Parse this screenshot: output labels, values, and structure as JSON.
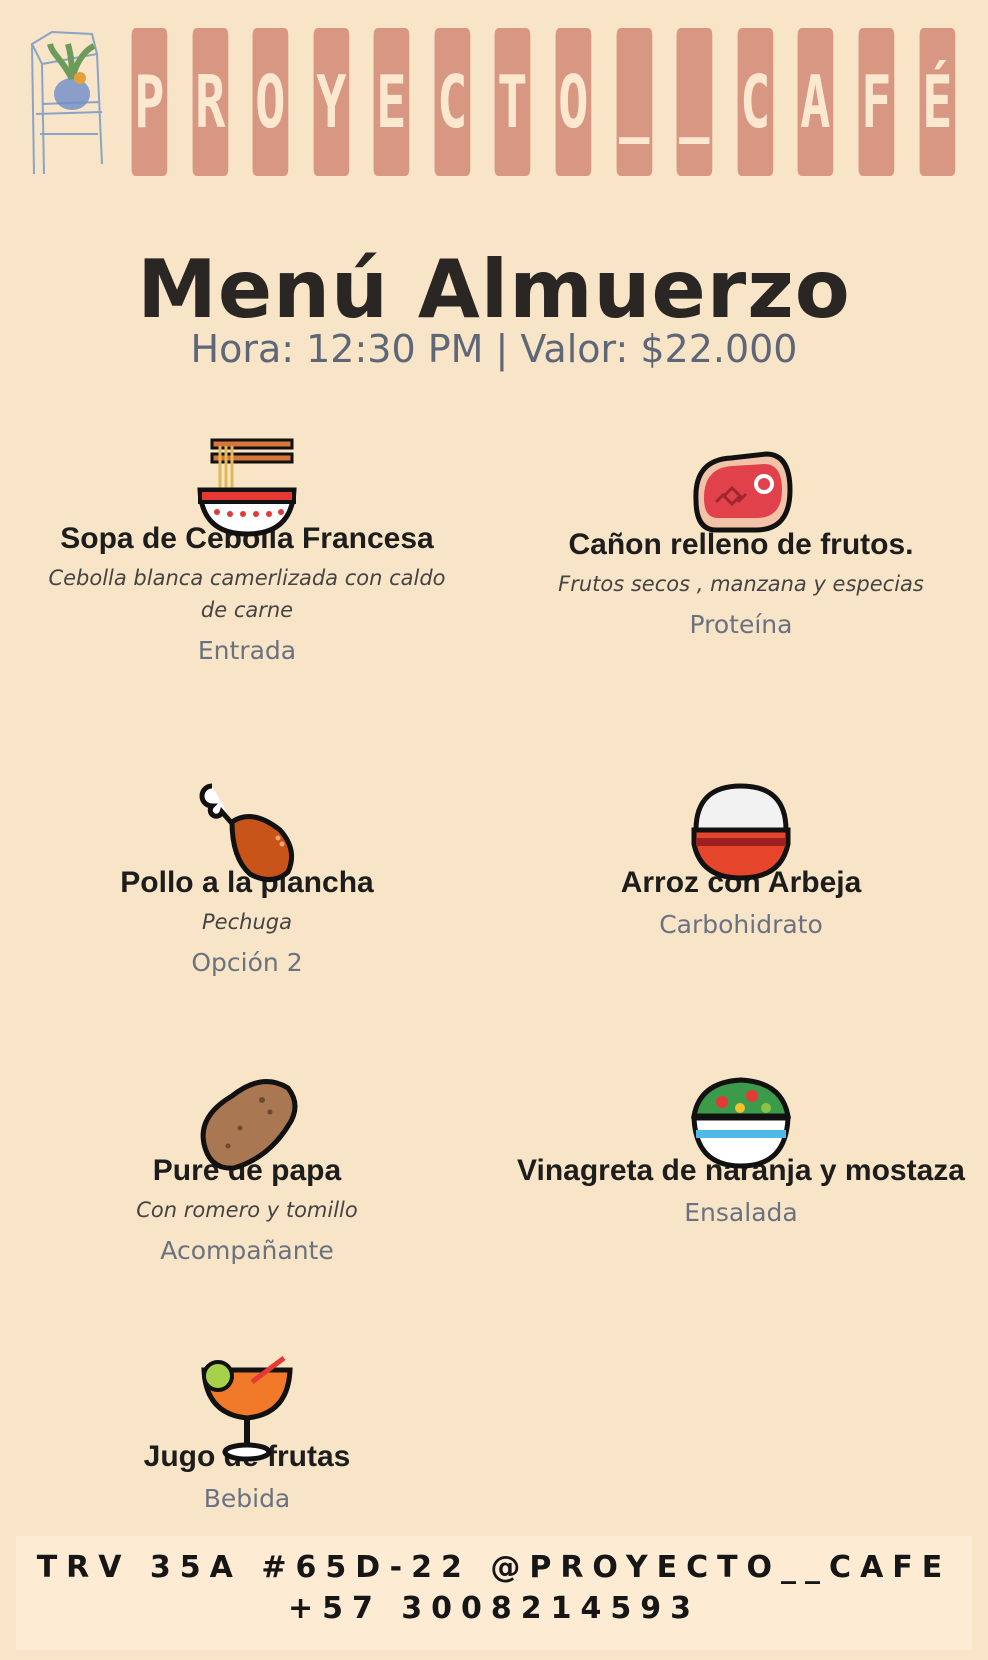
{
  "brand": {
    "letters": [
      "P",
      "R",
      "O",
      "Y",
      "E",
      "C",
      "T",
      "O",
      "_",
      "_",
      "C",
      "A",
      "F",
      "É"
    ],
    "tile_color": "#d89783",
    "letter_color": "#fbe8cf"
  },
  "header": {
    "title": "Menú Almuerzo",
    "subtitle": "Hora: 12:30 PM | Valor: $22.000"
  },
  "items": [
    {
      "icon": "ramen-bowl-icon",
      "name": "Sopa de Cebolla Francesa",
      "desc": "Cebolla blanca camerlizada con caldo de carne",
      "cat": "Entrada"
    },
    {
      "icon": "steak-icon",
      "name": "Cañon relleno de frutos.",
      "desc": "Frutos secos , manzana y especias",
      "cat": "Proteína"
    },
    {
      "icon": "chicken-leg-icon",
      "name": "Pollo a la plancha",
      "desc": "Pechuga",
      "cat": "Opción 2"
    },
    {
      "icon": "rice-bowl-icon",
      "name": "Arroz con Arbeja",
      "desc": "",
      "cat": "Carbohidrato"
    },
    {
      "icon": "potato-icon",
      "name": "Pure de papa",
      "desc": "Con romero y tomillo",
      "cat": "Acompañante"
    },
    {
      "icon": "salad-bowl-icon",
      "name": "Vinagreta de naranja y mostaza",
      "desc": "",
      "cat": "Ensalada"
    },
    {
      "icon": "tropical-drink-icon",
      "name": "Jugo de frutas",
      "desc": "",
      "cat": "Bebida"
    }
  ],
  "footer": {
    "line1": "TRV 35A #65D-22 @PROYECTO__CAFE",
    "line2": "+57 3008214593"
  }
}
